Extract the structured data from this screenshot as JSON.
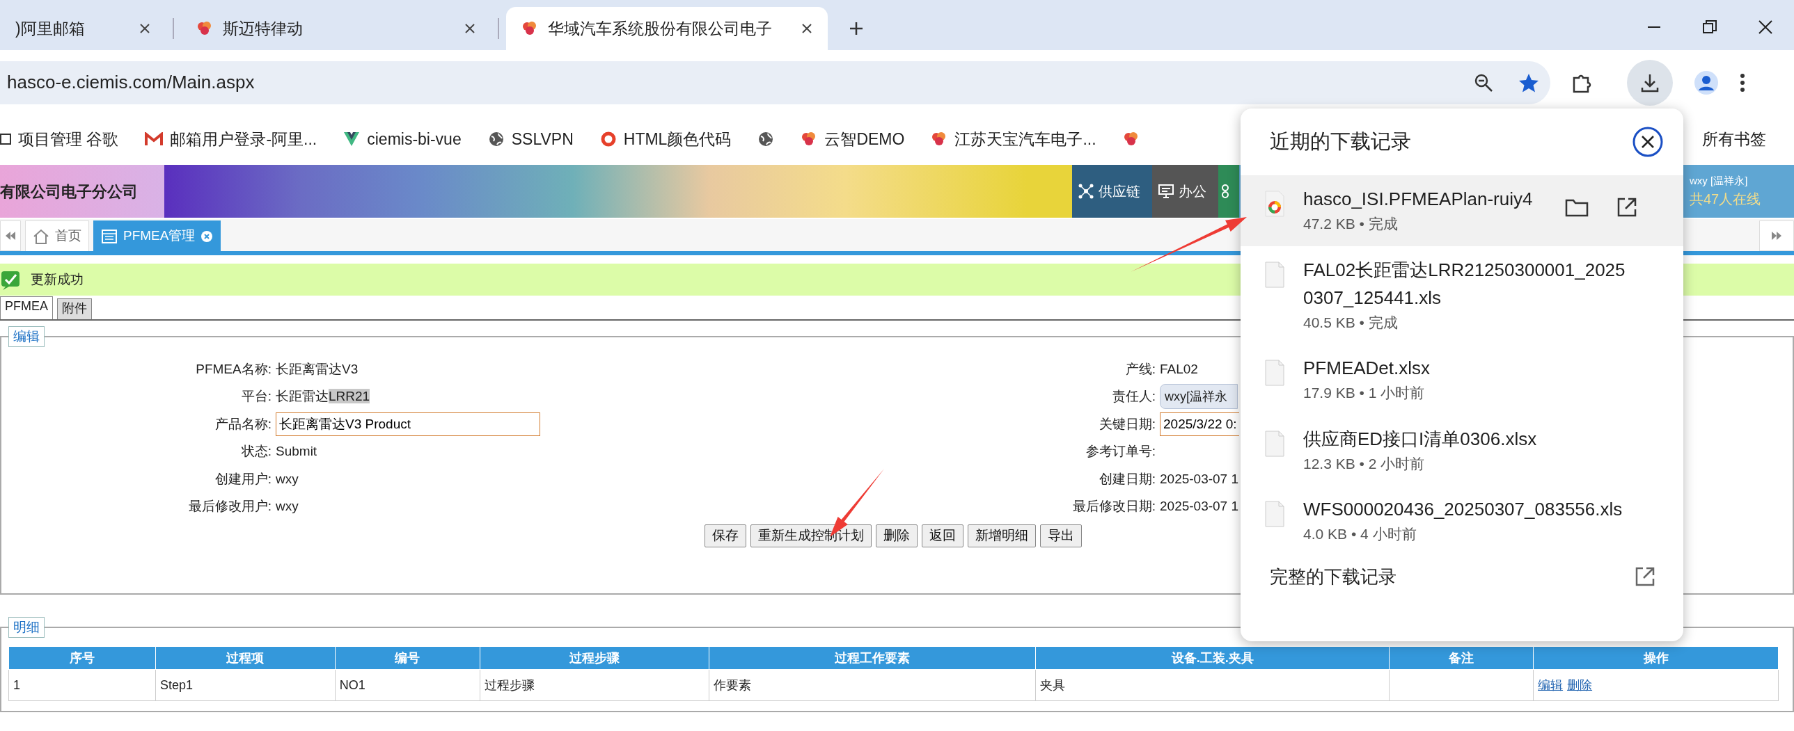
{
  "browser": {
    "tabs": [
      {
        "title": ")阿里邮箱",
        "selected": false
      },
      {
        "title": "斯迈特律动",
        "selected": false
      },
      {
        "title": "华域汽车系统股份有限公司电子",
        "selected": true
      }
    ],
    "address": "hasco-e.ciemis.com/Main.aspx",
    "bookmarks": [
      {
        "kind": "link",
        "label": "项目管理 谷歌"
      },
      {
        "kind": "link",
        "label": "邮箱用户登录-阿里..."
      },
      {
        "kind": "link",
        "label": "ciemis-bi-vue"
      },
      {
        "kind": "link",
        "label": "SSLVPN"
      },
      {
        "kind": "link",
        "label": "HTML颜色代码"
      },
      {
        "kind": "icon"
      },
      {
        "kind": "link",
        "label": "云智DEMO"
      },
      {
        "kind": "link",
        "label": "江苏天宝汽车电子..."
      },
      {
        "kind": "icon"
      }
    ],
    "all_bookmarks": "所有书签"
  },
  "app": {
    "banner_title": "有限公司电子分公司",
    "nav": [
      {
        "label": "供应链",
        "color": "#2e5e80"
      },
      {
        "label": "办公",
        "color": "#555555"
      },
      {
        "color": "#2e8b57"
      }
    ],
    "user": {
      "name": "wxy [温祥永]",
      "online": "共47人在线"
    },
    "page_tabs": [
      {
        "label": "首页",
        "selected": false
      },
      {
        "label": "PFMEA管理",
        "selected": true
      }
    ],
    "message": "更新成功",
    "sub_tabs": [
      {
        "label": "PFMEA",
        "selected": true
      },
      {
        "label": "附件",
        "selected": false
      }
    ],
    "edit": {
      "legend": "编辑",
      "rows": [
        {
          "left": {
            "label": "PFMEA名称:",
            "value": "长距离雷达V3",
            "kind": "text"
          },
          "right": {
            "label": "产线:",
            "value": "FAL02",
            "kind": "text"
          }
        },
        {
          "left": {
            "label": "平台:",
            "value": "长距雷达",
            "selection": "LRR21",
            "kind": "text"
          },
          "right": {
            "label": "责任人:",
            "value": "wxy[温祥永",
            "kind": "chip"
          }
        },
        {
          "left": {
            "label": "产品名称:",
            "value": "长距离雷达V3 Product",
            "kind": "input"
          },
          "right": {
            "label": "关键日期:",
            "value": "2025/3/22 0:",
            "kind": "input"
          }
        },
        {
          "left": {
            "label": "状态:",
            "value": "Submit",
            "kind": "text"
          },
          "right": {
            "label": "参考订单号:",
            "kind": "text"
          }
        },
        {
          "left": {
            "label": "创建用户:",
            "value": "wxy",
            "kind": "text"
          },
          "right": {
            "label": "创建日期:",
            "value": "2025-03-07 1",
            "kind": "text"
          }
        },
        {
          "left": {
            "label": "最后修改用户:",
            "value": "wxy",
            "kind": "text"
          },
          "right": {
            "label": "最后修改日期:",
            "value": "2025-03-07 1",
            "kind": "text"
          }
        }
      ],
      "buttons": [
        "保存",
        "重新生成控制计划",
        "删除",
        "返回",
        "新增明细",
        "导出"
      ]
    },
    "detail": {
      "legend": "明细",
      "columns": [
        "序号",
        "过程项",
        "编号",
        "过程步骤",
        "过程工作要素",
        "设备.工装.夹具",
        "备注",
        "操作"
      ],
      "rows": [
        {
          "seq": "1",
          "item": "Step1",
          "code": "NO1",
          "step": "过程步骤",
          "element": "作要素",
          "equipment": "夹具",
          "actions": [
            "编辑",
            "删除"
          ]
        }
      ]
    }
  },
  "downloads": {
    "title": "近期的下载记录",
    "items": [
      {
        "name": "hasco_ISI.PFMEAPlan-ruiy4",
        "meta": "47.2 KB • 完成",
        "kind": "pdf",
        "highlighted": true
      },
      {
        "name": "FAL02长距雷达LRR21250300001_20250307_125441.xls",
        "meta": "40.5 KB • 完成",
        "kind": "file",
        "highlighted": false
      },
      {
        "name": "PFMEADet.xlsx",
        "meta": "17.9 KB • 1 小时前",
        "kind": "file",
        "highlighted": false
      },
      {
        "name": "供应商ED接口I清单0306.xlsx",
        "meta": "12.3 KB • 2 小时前",
        "kind": "file",
        "highlighted": false
      },
      {
        "name": "WFS000020436_20250307_083556.xls",
        "meta": "4.0 KB • 4 小时前",
        "kind": "file",
        "highlighted": false
      }
    ],
    "footer": "完整的下载记录"
  }
}
